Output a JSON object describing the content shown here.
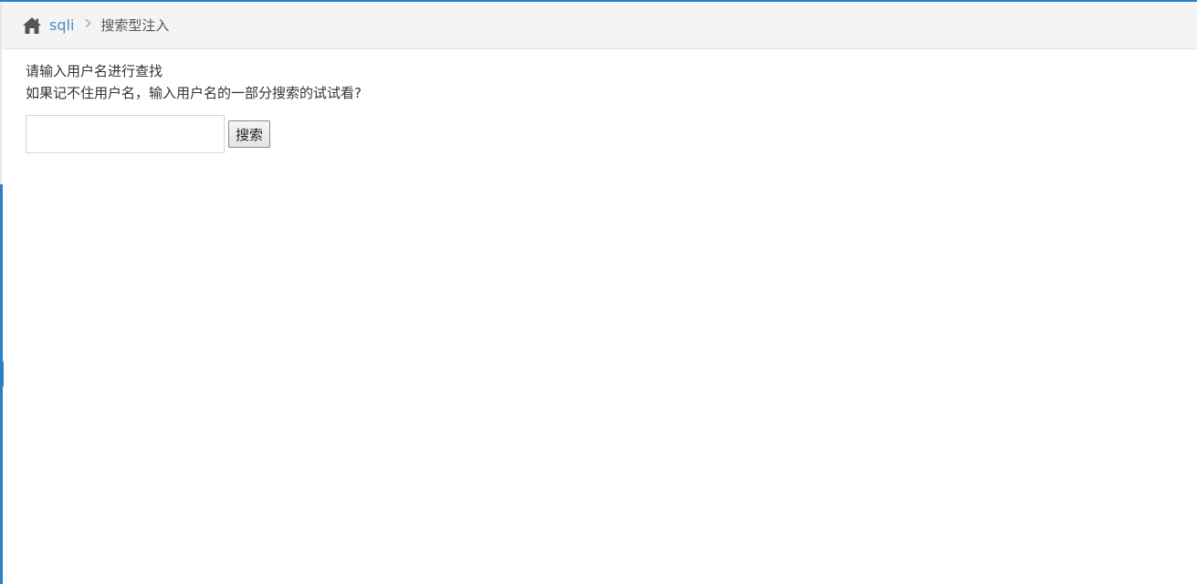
{
  "breadcrumb": {
    "home_icon": "home-icon",
    "link_label": "sqli",
    "separator_icon": "chevron-right-icon",
    "current_label": "搜索型注入"
  },
  "main": {
    "prompt_line1": "请输入用户名进行查找",
    "prompt_line2": "如果记不住用户名，输入用户名的一部分搜索的试试看?",
    "search_value": "",
    "search_button_label": "搜索"
  },
  "colors": {
    "accent": "#2b7fc3",
    "link": "#4a90c8",
    "breadcrumb_bg": "#f4f4f4"
  }
}
